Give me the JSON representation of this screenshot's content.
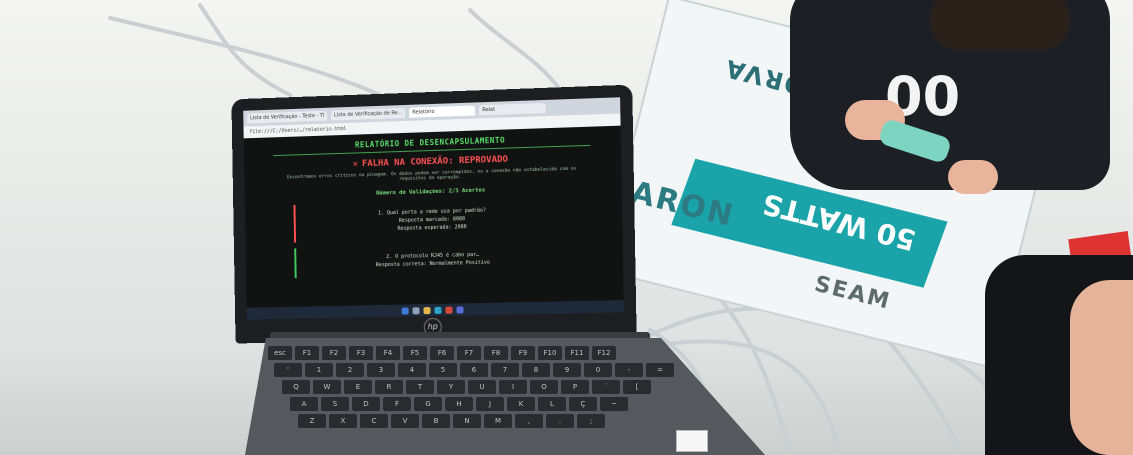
{
  "laptop": {
    "brand_logo": "hp",
    "browser": {
      "tabs": [
        "Lista de Verificação - Teste - TI",
        "Lista de Verificação de Re...",
        "Relatório",
        "Relat"
      ],
      "address": "file:///C:/Users/…/relatorio.html"
    },
    "report": {
      "title": "RELATÓRIO DE DESENCAPSULAMENTO",
      "status_icon": "close-x-icon",
      "status": "FALHA NA CONEXÃO: REPROVADO",
      "description": "Encontramos erros críticos na pinagem. Os dados podem ser corrompidos, ou a conexão não estabelecida com os requisitos da operação.",
      "score": "Número de Validações: 2/3 Acertos",
      "questions": [
        {
          "q": "1. Qual porta a rede usa por padrão?",
          "given": "Resposta marcada: 8080",
          "expected": "Resposta esperada: 2000",
          "correct": false
        },
        {
          "q": "2. O protocolo RJ45 é cabo par…",
          "given": "Resposta correta: Normalmente Positivo",
          "correct": true
        }
      ]
    },
    "taskbar_icons": [
      "windows-icon",
      "search-icon",
      "files-icon",
      "edge-icon",
      "chrome-icon",
      "store-icon"
    ]
  },
  "box_print": {
    "brand_top": "NORVA",
    "brand_side": "ARON",
    "brand_seam": "SEAM",
    "watts": "50 WATTS"
  },
  "shirt_print": "00",
  "keyboard_rows": [
    [
      "esc",
      "F1",
      "F2",
      "F3",
      "F4",
      "F5",
      "F6",
      "F7",
      "F8",
      "F9",
      "F10",
      "F11",
      "F12"
    ],
    [
      "'",
      "1",
      "2",
      "3",
      "4",
      "5",
      "6",
      "7",
      "8",
      "9",
      "0",
      "-",
      "="
    ],
    [
      "Q",
      "W",
      "E",
      "R",
      "T",
      "Y",
      "U",
      "I",
      "O",
      "P",
      "´",
      "["
    ],
    [
      "A",
      "S",
      "D",
      "F",
      "G",
      "H",
      "J",
      "K",
      "L",
      "Ç",
      "~"
    ],
    [
      "Z",
      "X",
      "C",
      "V",
      "B",
      "N",
      "M",
      ",",
      ".",
      ";"
    ]
  ],
  "colors": {
    "report_green": "#5be06a",
    "fail_red": "#ff5252",
    "box_teal": "#1aa3a8"
  }
}
